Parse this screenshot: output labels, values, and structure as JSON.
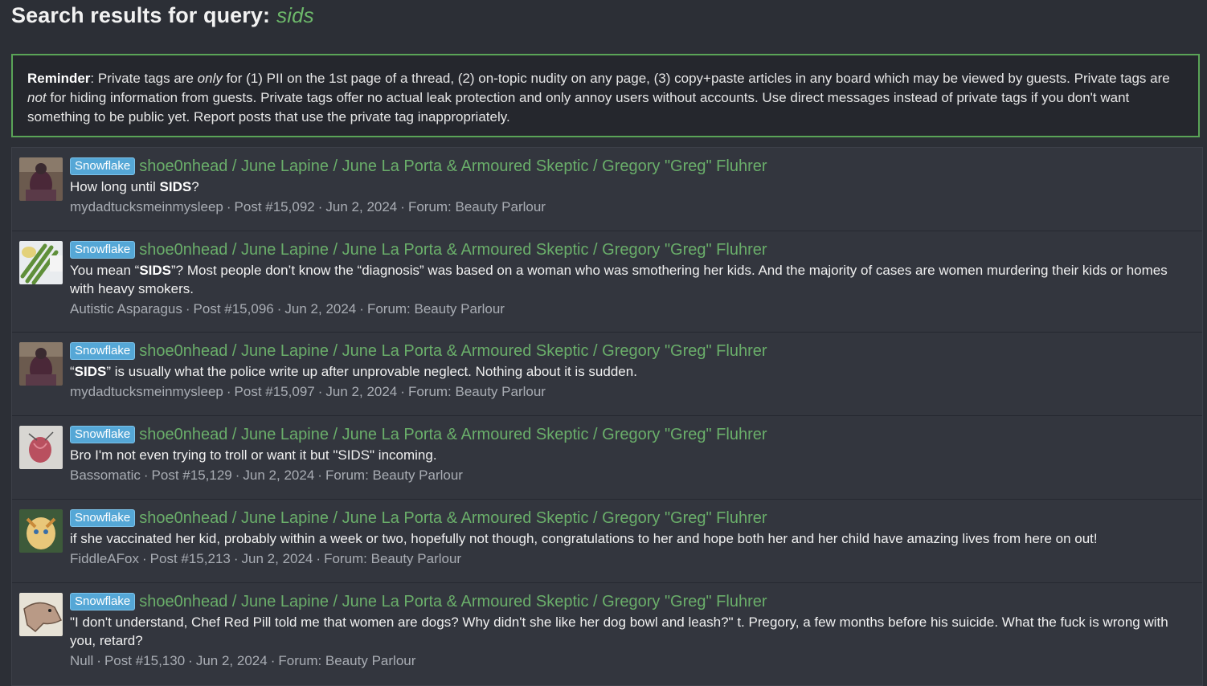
{
  "header": {
    "title": "Search results for query:",
    "query": "sids"
  },
  "notice": {
    "lead": "Reminder",
    "t1": ": Private tags are ",
    "em1": "only",
    "t2": " for (1) PII on the 1st page of a thread, (2) on-topic nudity on any page, (3) copy+paste articles in any board which may be viewed by guests. Private tags are ",
    "em2": "not",
    "t3": " for hiding information from guests. Private tags offer no actual leak protection and only annoy users without accounts. Use direct messages instead of private tags if you don't want something to be public yet. Report posts that use the private tag inappropriately."
  },
  "results": [
    {
      "prefix": "Snowflake",
      "thread": "shoe0nhead / June Lapine / June La Porta & Armoured Skeptic / Gregory \"Greg\" Fluhrer",
      "snippet_pre": "How long until ",
      "snippet_hl": "SIDS",
      "snippet_post": "?",
      "user": "mydadtucksmeinmysleep",
      "post": "Post #15,092",
      "date": "Jun 2, 2024",
      "forum": "Forum: Beauty Parlour"
    },
    {
      "prefix": "Snowflake",
      "thread": "shoe0nhead / June Lapine / June La Porta & Armoured Skeptic / Gregory \"Greg\" Fluhrer",
      "snippet_pre": "You mean “",
      "snippet_hl": "SIDS",
      "snippet_post": "”? Most people don’t know the “diagnosis” was based on a woman who was smothering her kids. And the majority of cases are women murdering their kids or homes with heavy smokers.",
      "user": "Autistic Asparagus",
      "post": "Post #15,096",
      "date": "Jun 2, 2024",
      "forum": "Forum: Beauty Parlour"
    },
    {
      "prefix": "Snowflake",
      "thread": "shoe0nhead / June Lapine / June La Porta & Armoured Skeptic / Gregory \"Greg\" Fluhrer",
      "snippet_pre": "“",
      "snippet_hl": "SIDS",
      "snippet_post": "” is usually what the police write up after unprovable neglect. Nothing about it is sudden.",
      "user": "mydadtucksmeinmysleep",
      "post": "Post #15,097",
      "date": "Jun 2, 2024",
      "forum": "Forum: Beauty Parlour"
    },
    {
      "prefix": "Snowflake",
      "thread": "shoe0nhead / June Lapine / June La Porta & Armoured Skeptic / Gregory \"Greg\" Fluhrer",
      "snippet_pre": "Bro I'm not even trying to troll or want it but \"SIDS\" incoming.",
      "snippet_hl": "",
      "snippet_post": "",
      "user": "Bassomatic",
      "post": "Post #15,129",
      "date": "Jun 2, 2024",
      "forum": "Forum: Beauty Parlour"
    },
    {
      "prefix": "Snowflake",
      "thread": "shoe0nhead / June Lapine / June La Porta & Armoured Skeptic / Gregory \"Greg\" Fluhrer",
      "snippet_pre": "if she vaccinated her kid, probably within a week or two, hopefully not though, congratulations to her and hope both her and her child have amazing lives from here on out!",
      "snippet_hl": "",
      "snippet_post": "",
      "user": "FiddleAFox",
      "post": "Post #15,213",
      "date": "Jun 2, 2024",
      "forum": "Forum: Beauty Parlour"
    },
    {
      "prefix": "Snowflake",
      "thread": "shoe0nhead / June Lapine / June La Porta & Armoured Skeptic / Gregory \"Greg\" Fluhrer",
      "snippet_pre": "\"I don't understand, Chef Red Pill told me that women are dogs? Why didn't she like her dog bowl and leash?\" t. Pregory, a few months before his suicide. What the fuck is wrong with you, retard?",
      "snippet_hl": "",
      "snippet_post": "",
      "user": "Null",
      "post": "Post #15,130",
      "date": "Jun 2, 2024",
      "forum": "Forum: Beauty Parlour"
    }
  ],
  "meta_separator": "·",
  "colors": {
    "accent_green": "#6aae6a",
    "prefix_blue": "#55a7d6",
    "notice_border": "#5aa457"
  }
}
